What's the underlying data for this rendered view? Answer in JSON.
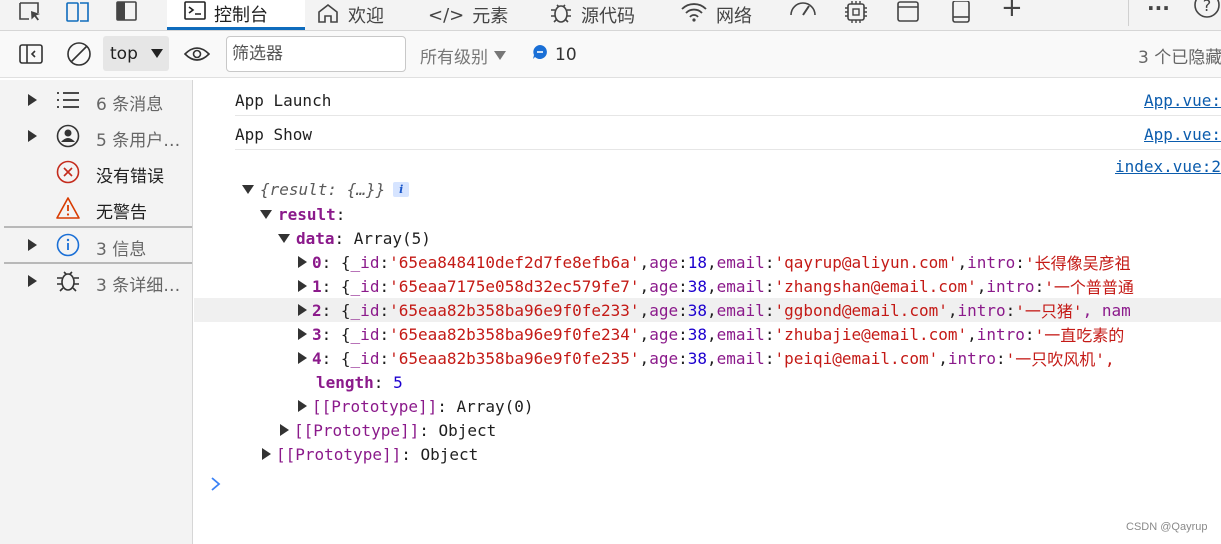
{
  "tabs": [
    {
      "label": "控制台",
      "icon": "console-icon"
    },
    {
      "label": "欢迎",
      "icon": "home-icon"
    },
    {
      "label": "元素",
      "icon": "code-icon"
    },
    {
      "label": "源代码",
      "icon": "bug-icon"
    },
    {
      "label": "网络",
      "icon": "wifi-icon"
    }
  ],
  "toolbar": {
    "context": "top",
    "filter_placeholder": "筛选器",
    "levels": "所有级别",
    "issues_count": "10",
    "hidden": "3 个已隐藏"
  },
  "sidebar": [
    {
      "label": "6 条消息",
      "icon": "list-icon"
    },
    {
      "label": "5 条用户…",
      "icon": "user-icon"
    },
    {
      "label": "没有错误",
      "icon": "error-icon"
    },
    {
      "label": "无警告",
      "icon": "warning-icon"
    },
    {
      "label": "3 信息",
      "icon": "info-icon"
    },
    {
      "label": "3 条详细…",
      "icon": "bug-icon"
    }
  ],
  "console": {
    "messages": [
      {
        "text": "App Launch",
        "source": "App.vue:"
      },
      {
        "text": "App Show",
        "source": "App.vue:"
      }
    ],
    "object_source": "index.vue:2",
    "object_summary": "{result: {…}}",
    "result_key": "result",
    "data_key": "data",
    "data_type": "Array(5)",
    "items": [
      {
        "index": "0",
        "id": "'65ea848410def2d7fe8efb6a'",
        "age": "18",
        "email": "'qayrup@aliyun.com'",
        "intro": "'长得像吴彦祖"
      },
      {
        "index": "1",
        "id": "'65eaa7175e058d32ec579fe7'",
        "age": "38",
        "email": "'zhangshan@email.com'",
        "intro": "'一个普普通"
      },
      {
        "index": "2",
        "id": "'65eaa82b358ba96e9f0fe233'",
        "age": "38",
        "email": "'ggbond@email.com'",
        "intro": "'一只猪'",
        "tail": ", nam"
      },
      {
        "index": "3",
        "id": "'65eaa82b358ba96e9f0fe234'",
        "age": "38",
        "email": "'zhubajie@email.com'",
        "intro": "'一直吃素的"
      },
      {
        "index": "4",
        "id": "'65eaa82b358ba96e9f0fe235'",
        "age": "38",
        "email": "'peiqi@email.com'",
        "intro": "'一只吹风机',"
      }
    ],
    "length_key": "length",
    "length_value": "5",
    "proto_key": "[[Prototype]]",
    "proto_array": "Array(0)",
    "proto_object": "Object"
  },
  "watermark": "CSDN @Qayrup"
}
